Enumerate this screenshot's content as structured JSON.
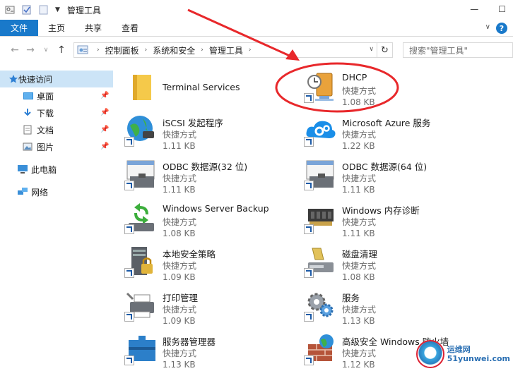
{
  "window": {
    "title": "管理工具"
  },
  "ribbon": {
    "tabs": [
      "文件",
      "主页",
      "共享",
      "查看"
    ],
    "help": "?"
  },
  "address": {
    "crumbs": [
      "控制面板",
      "系统和安全",
      "管理工具"
    ]
  },
  "search": {
    "placeholder": "搜索\"管理工具\""
  },
  "sidebar": {
    "quick_access": "快速访问",
    "items": [
      {
        "label": "桌面",
        "icon": "desktop-icon"
      },
      {
        "label": "下载",
        "icon": "download-icon"
      },
      {
        "label": "文档",
        "icon": "document-icon"
      },
      {
        "label": "图片",
        "icon": "picture-icon"
      }
    ],
    "this_pc": "此电脑",
    "network": "网络"
  },
  "files": [
    {
      "name": "Terminal Services",
      "type": "",
      "size": "",
      "icon": "folder-icon"
    },
    {
      "name": "DHCP",
      "type": "快捷方式",
      "size": "1.08 KB",
      "icon": "dhcp-icon"
    },
    {
      "name": "iSCSI 发起程序",
      "type": "快捷方式",
      "size": "1.11 KB",
      "icon": "globe-icon"
    },
    {
      "name": "Microsoft Azure 服务",
      "type": "快捷方式",
      "size": "1.22 KB",
      "icon": "cloud-gear-icon"
    },
    {
      "name": "ODBC 数据源(32 位)",
      "type": "快捷方式",
      "size": "1.11 KB",
      "icon": "toolbox-icon"
    },
    {
      "name": "ODBC 数据源(64 位)",
      "type": "快捷方式",
      "size": "1.11 KB",
      "icon": "toolbox-icon"
    },
    {
      "name": "Windows Server Backup",
      "type": "快捷方式",
      "size": "1.08 KB",
      "icon": "backup-icon"
    },
    {
      "name": "Windows 内存诊断",
      "type": "快捷方式",
      "size": "1.11 KB",
      "icon": "memory-chip-icon"
    },
    {
      "name": "本地安全策略",
      "type": "快捷方式",
      "size": "1.09 KB",
      "icon": "lock-server-icon"
    },
    {
      "name": "磁盘清理",
      "type": "快捷方式",
      "size": "1.08 KB",
      "icon": "disk-cleanup-icon"
    },
    {
      "name": "打印管理",
      "type": "快捷方式",
      "size": "1.09 KB",
      "icon": "printer-icon"
    },
    {
      "name": "服务",
      "type": "快捷方式",
      "size": "1.13 KB",
      "icon": "gears-icon"
    },
    {
      "name": "服务器管理器",
      "type": "快捷方式",
      "size": "1.13 KB",
      "icon": "server-manager-icon"
    },
    {
      "name": "高级安全 Windows 防火墙",
      "type": "快捷方式",
      "size": "1.12 KB",
      "icon": "firewall-icon"
    }
  ],
  "watermark": {
    "line1": "运维网",
    "line2": "51yunwei.com"
  },
  "colors": {
    "accent": "#1979ca",
    "selected": "#cce4f7",
    "annotation": "#e8282b"
  }
}
